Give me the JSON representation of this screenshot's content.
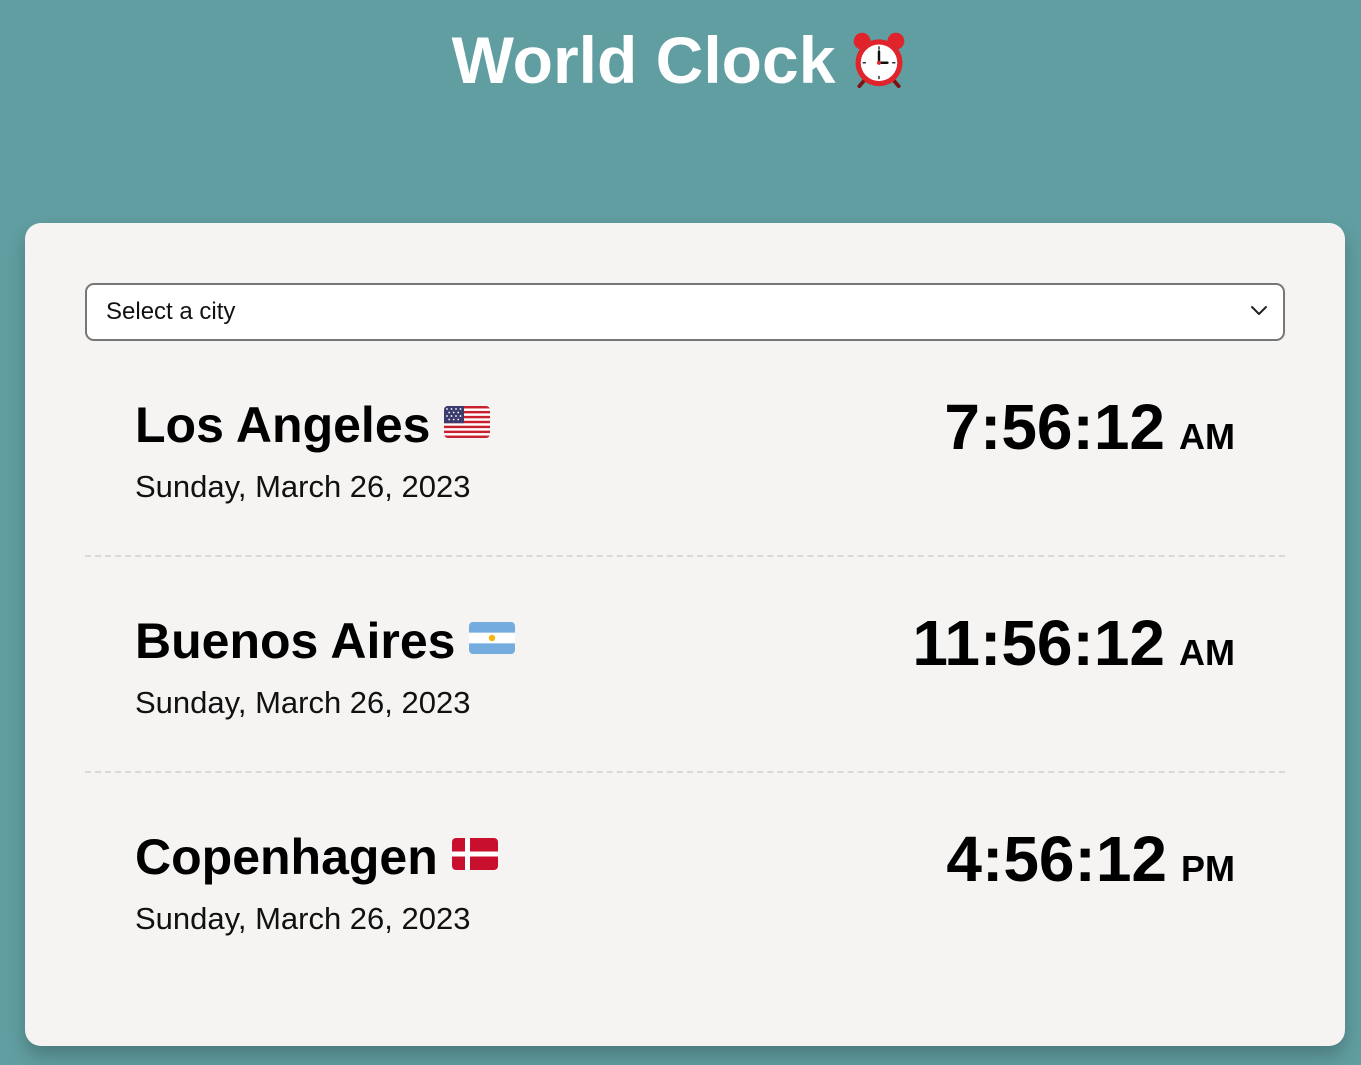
{
  "header": {
    "title": "World Clock",
    "title_icon": "alarm-clock-icon"
  },
  "city_select": {
    "selected_label": "Select a city",
    "icon": "chevron-down-icon"
  },
  "cities": [
    {
      "name": "Los Angeles",
      "flag": "us-flag-icon",
      "date": "Sunday, March 26, 2023",
      "time": "7:56:12",
      "ampm": "AM"
    },
    {
      "name": "Buenos Aires",
      "flag": "argentina-flag-icon",
      "date": "Sunday, March 26, 2023",
      "time": "11:56:12",
      "ampm": "AM"
    },
    {
      "name": "Copenhagen",
      "flag": "denmark-flag-icon",
      "date": "Sunday, March 26, 2023",
      "time": "4:56:12",
      "ampm": "PM"
    }
  ],
  "colors": {
    "background": "#619ea1",
    "card": "#f5f4f2",
    "divider": "#d9d9d9",
    "title_text": "#ffffff",
    "alarm_red": "#e0242b"
  }
}
